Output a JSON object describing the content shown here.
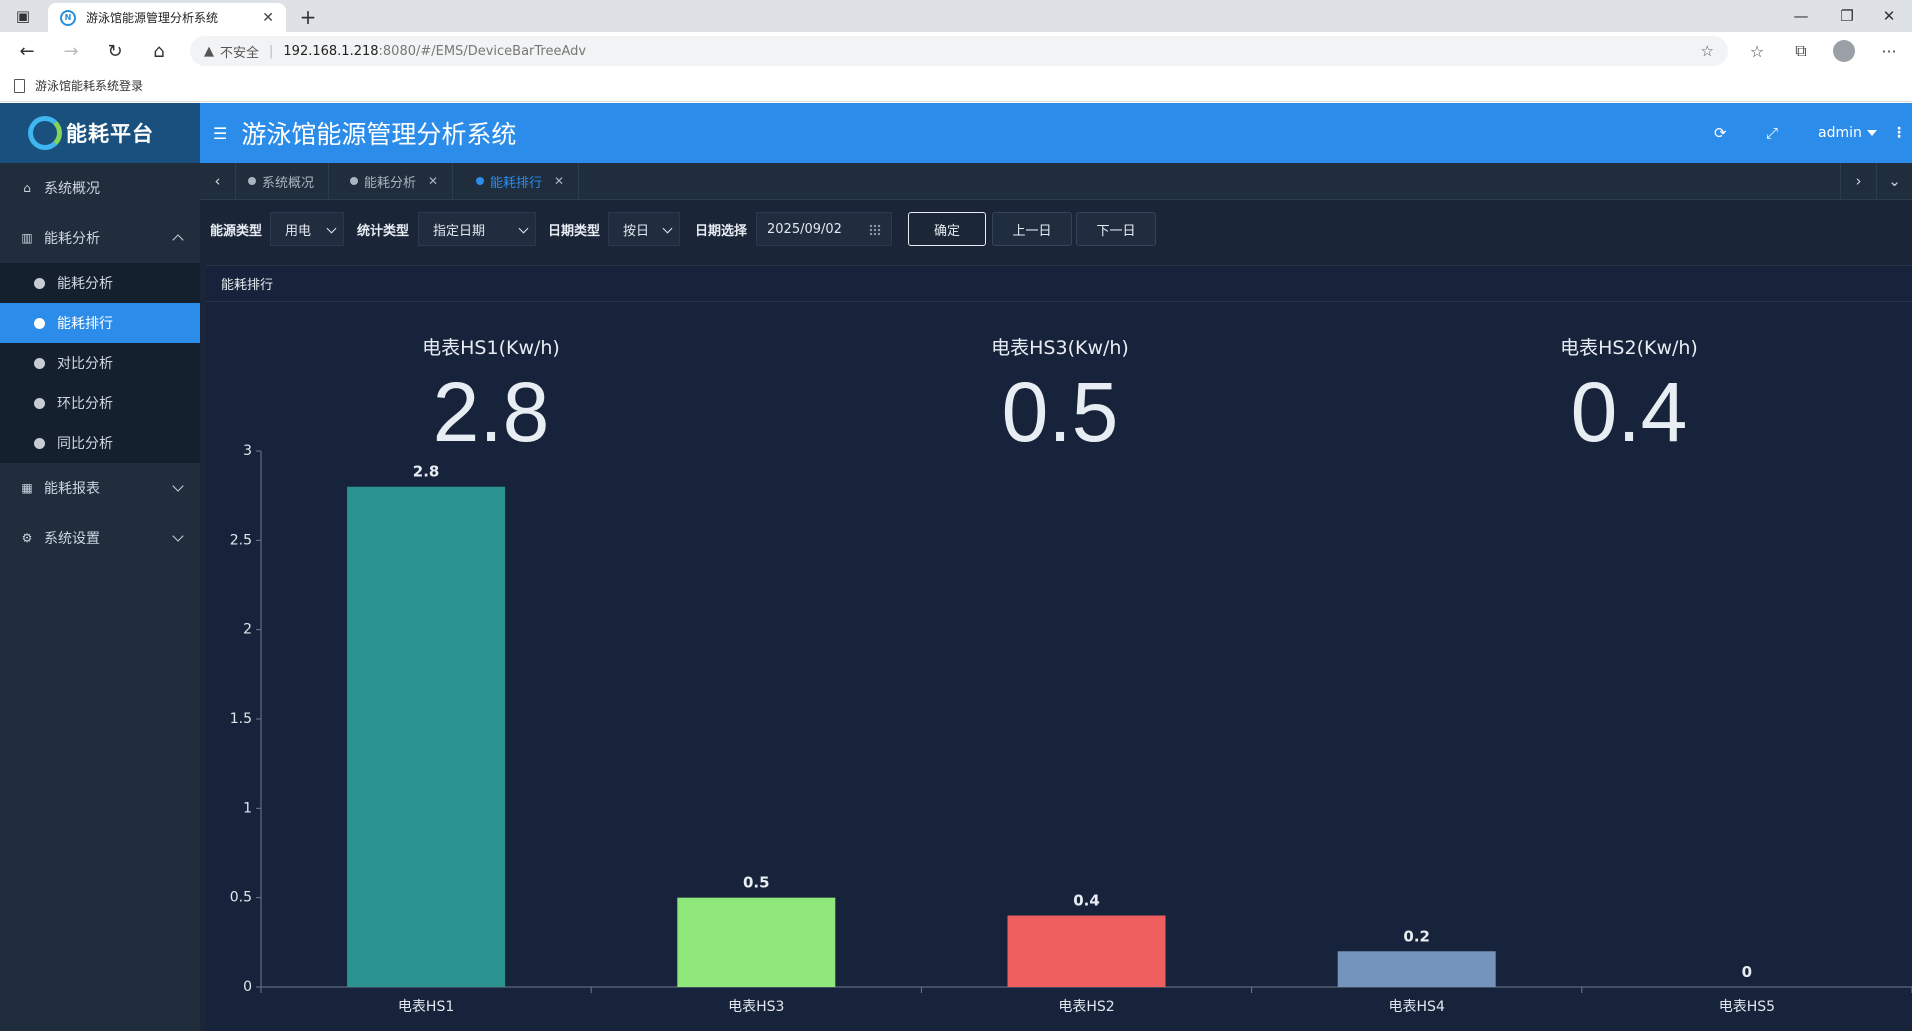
{
  "browser": {
    "tab_title": "游泳馆能源管理分析系统",
    "security_label": "不安全",
    "url_host": "192.168.1.218",
    "url_path": ":8080/#/EMS/DeviceBarTreeAdv",
    "bookmark": "游泳馆能耗系统登录"
  },
  "app": {
    "logo_text": "能耗平台",
    "title": "游泳馆能源管理分析系统",
    "user": "admin"
  },
  "sidebar": {
    "items": [
      {
        "label": "系统概况",
        "icon": "home-icon"
      },
      {
        "label": "能耗分析",
        "icon": "bar-chart-icon",
        "expanded": true,
        "children": [
          "能耗分析",
          "能耗排行",
          "对比分析",
          "环比分析",
          "同比分析"
        ]
      },
      {
        "label": "能耗报表",
        "icon": "table-icon"
      },
      {
        "label": "系统设置",
        "icon": "gear-icon"
      }
    ],
    "active_child": "能耗排行"
  },
  "tabs": [
    {
      "label": "系统概况",
      "closable": false
    },
    {
      "label": "能耗分析",
      "closable": true
    },
    {
      "label": "能耗排行",
      "closable": true,
      "active": true
    }
  ],
  "filters": {
    "energy_type_label": "能源类型",
    "energy_type_value": "用电",
    "stat_type_label": "统计类型",
    "stat_type_value": "指定日期",
    "date_type_label": "日期类型",
    "date_type_value": "按日",
    "date_select_label": "日期选择",
    "date_value": "2025/09/02",
    "confirm_label": "确定",
    "prev_label": "上一日",
    "next_label": "下一日"
  },
  "panel_title": "能耗排行",
  "kpis": [
    {
      "title": "电表HS1(Kw/h)",
      "value": "2.8"
    },
    {
      "title": "电表HS3(Kw/h)",
      "value": "0.5"
    },
    {
      "title": "电表HS2(Kw/h)",
      "value": "0.4"
    }
  ],
  "chart_data": {
    "type": "bar",
    "categories": [
      "电表HS1",
      "电表HS3",
      "电表HS2",
      "电表HS4",
      "电表HS5"
    ],
    "values": [
      2.8,
      0.5,
      0.4,
      0.2,
      0
    ],
    "colors": [
      "#2a9390",
      "#8fe67a",
      "#f05f5f",
      "#7594bd",
      "#7594bd"
    ],
    "ylim": [
      0,
      3
    ],
    "yticks": [
      "0",
      "0.5",
      "1",
      "1.5",
      "2",
      "2.5",
      "3"
    ],
    "data_labels": [
      "2.8",
      "0.5",
      "0.4",
      "0.2",
      "0"
    ],
    "grid": false,
    "title": "",
    "xlabel": "",
    "ylabel": ""
  }
}
